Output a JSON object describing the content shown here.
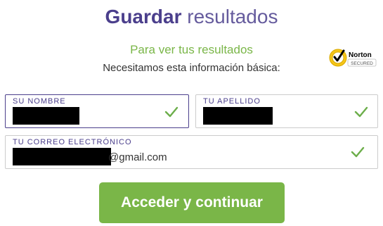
{
  "heading": {
    "strong": "Guardar",
    "light": "resultados"
  },
  "subtitle": "Para ver tus resultados",
  "info": "Necesitamos esta información básica:",
  "badge": {
    "brand": "Norton",
    "sub": "SECURED",
    "icon": "checkmark-seal-icon"
  },
  "fields": {
    "first_name": {
      "label": "SU NOMBRE",
      "valid": true
    },
    "last_name": {
      "label": "TU APELLIDO",
      "valid": true
    },
    "email": {
      "label": "TU CORREO ELECTRÓNICO",
      "value_visible": "@gmail.com",
      "valid": true
    }
  },
  "submit_label": "Acceder y continuar",
  "colors": {
    "brand_purple": "#4b3f8c",
    "accent_green": "#7ab648",
    "check_green": "#6cae4a"
  }
}
